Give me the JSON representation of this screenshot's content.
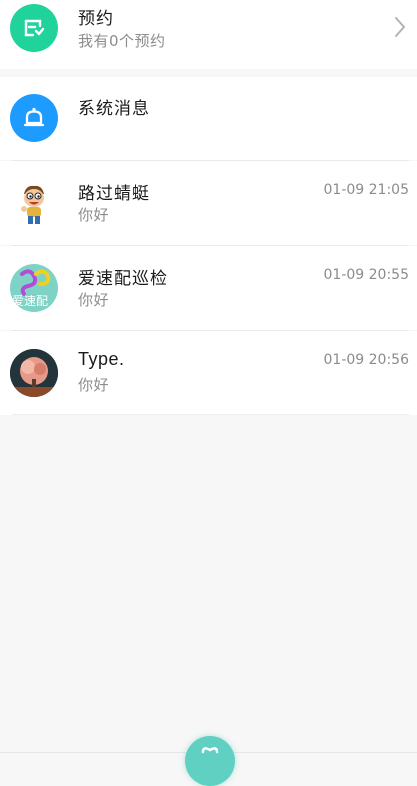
{
  "appointment": {
    "title": "预约",
    "subtitle": "我有0个预约",
    "icon": "calendar-check-icon",
    "color": "#1fd39a"
  },
  "system_message": {
    "title": "系统消息",
    "icon": "bell-icon",
    "color": "#1e9bff"
  },
  "chats": [
    {
      "name": "路过蜻蜓",
      "message": "你好",
      "time": "01-09 21:05",
      "avatar": "cartoon-boy-avatar"
    },
    {
      "name": "爱速配巡检",
      "message": "你好",
      "time": "01-09 20:55",
      "avatar": "asp-logo-avatar",
      "avatar_text": "爱速配"
    },
    {
      "name": "Type.",
      "message": "你好",
      "time": "01-09 20:56",
      "avatar": "tree-photo-avatar"
    }
  ],
  "nav": {
    "center_icon": "home-heart-icon"
  }
}
